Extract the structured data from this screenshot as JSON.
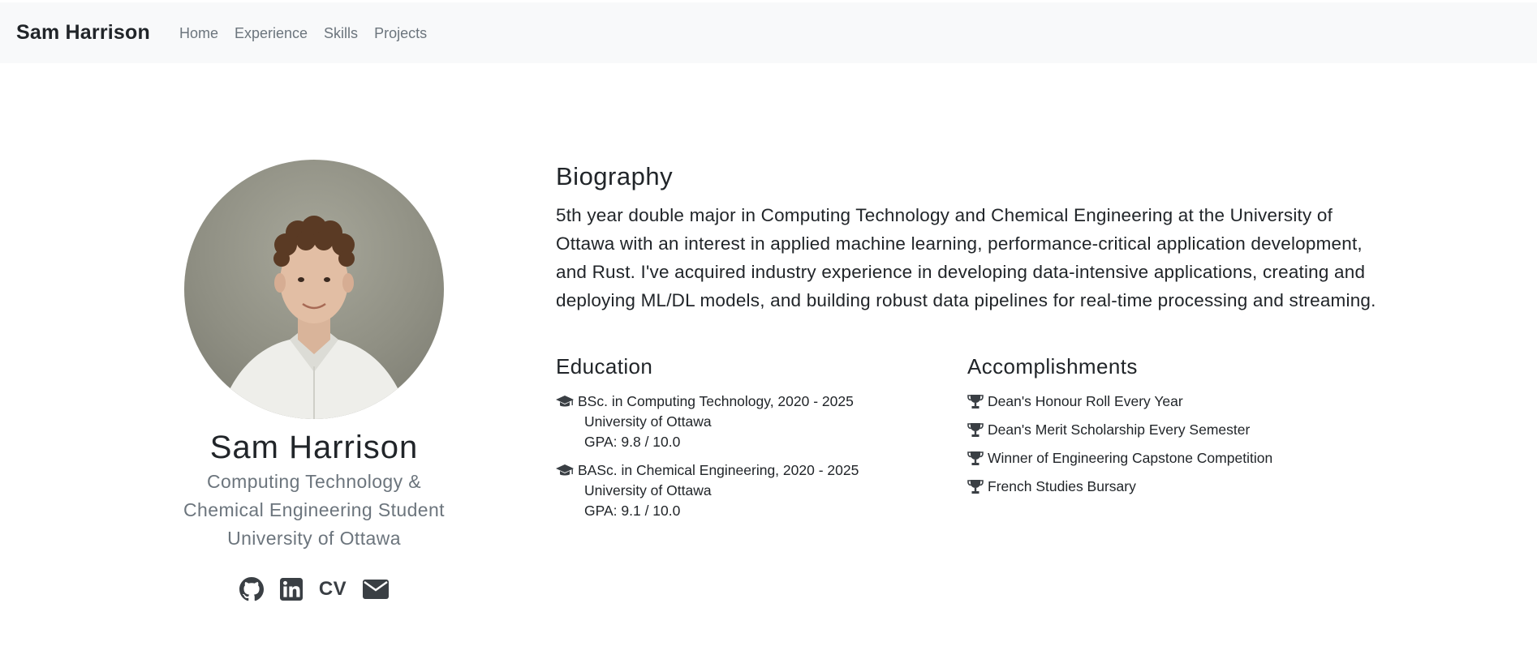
{
  "nav": {
    "brand": "Sam Harrison",
    "links": [
      "Home",
      "Experience",
      "Skills",
      "Projects"
    ]
  },
  "profile": {
    "name": "Sam Harrison",
    "subtitle_line1": "Computing Technology &",
    "subtitle_line2": "Chemical Engineering Student",
    "subtitle_line3": "University of Ottawa",
    "social": {
      "github_icon": "github-icon",
      "linkedin_icon": "linkedin-icon",
      "cv_label": "CV",
      "email_icon": "envelope-icon"
    }
  },
  "biography": {
    "title": "Biography",
    "text": "5th year double major in Computing Technology and Chemical Engineering at the University of Ottawa with an interest in applied machine learning, performance-critical application development, and Rust. I've acquired industry experience in developing data-intensive applications, creating and deploying ML/DL models, and building robust data pipelines for real-time processing and streaming."
  },
  "education": {
    "title": "Education",
    "items": [
      {
        "degree": "BSc. in Computing Technology, 2020 - 2025",
        "school": "University of Ottawa",
        "gpa": "GPA: 9.8 / 10.0"
      },
      {
        "degree": "BASc. in Chemical Engineering, 2020 - 2025",
        "school": "University of Ottawa",
        "gpa": "GPA: 9.1 / 10.0"
      }
    ]
  },
  "accomplishments": {
    "title": "Accomplishments",
    "items": [
      "Dean's Honour Roll Every Year",
      "Dean's Merit Scholarship Every Semester",
      "Winner of Engineering Capstone Competition",
      "French Studies Bursary"
    ]
  },
  "colors": {
    "navbar_bg": "#f8f9fa",
    "text": "#212529",
    "muted": "#6c757d",
    "icon": "#3a3f44"
  }
}
